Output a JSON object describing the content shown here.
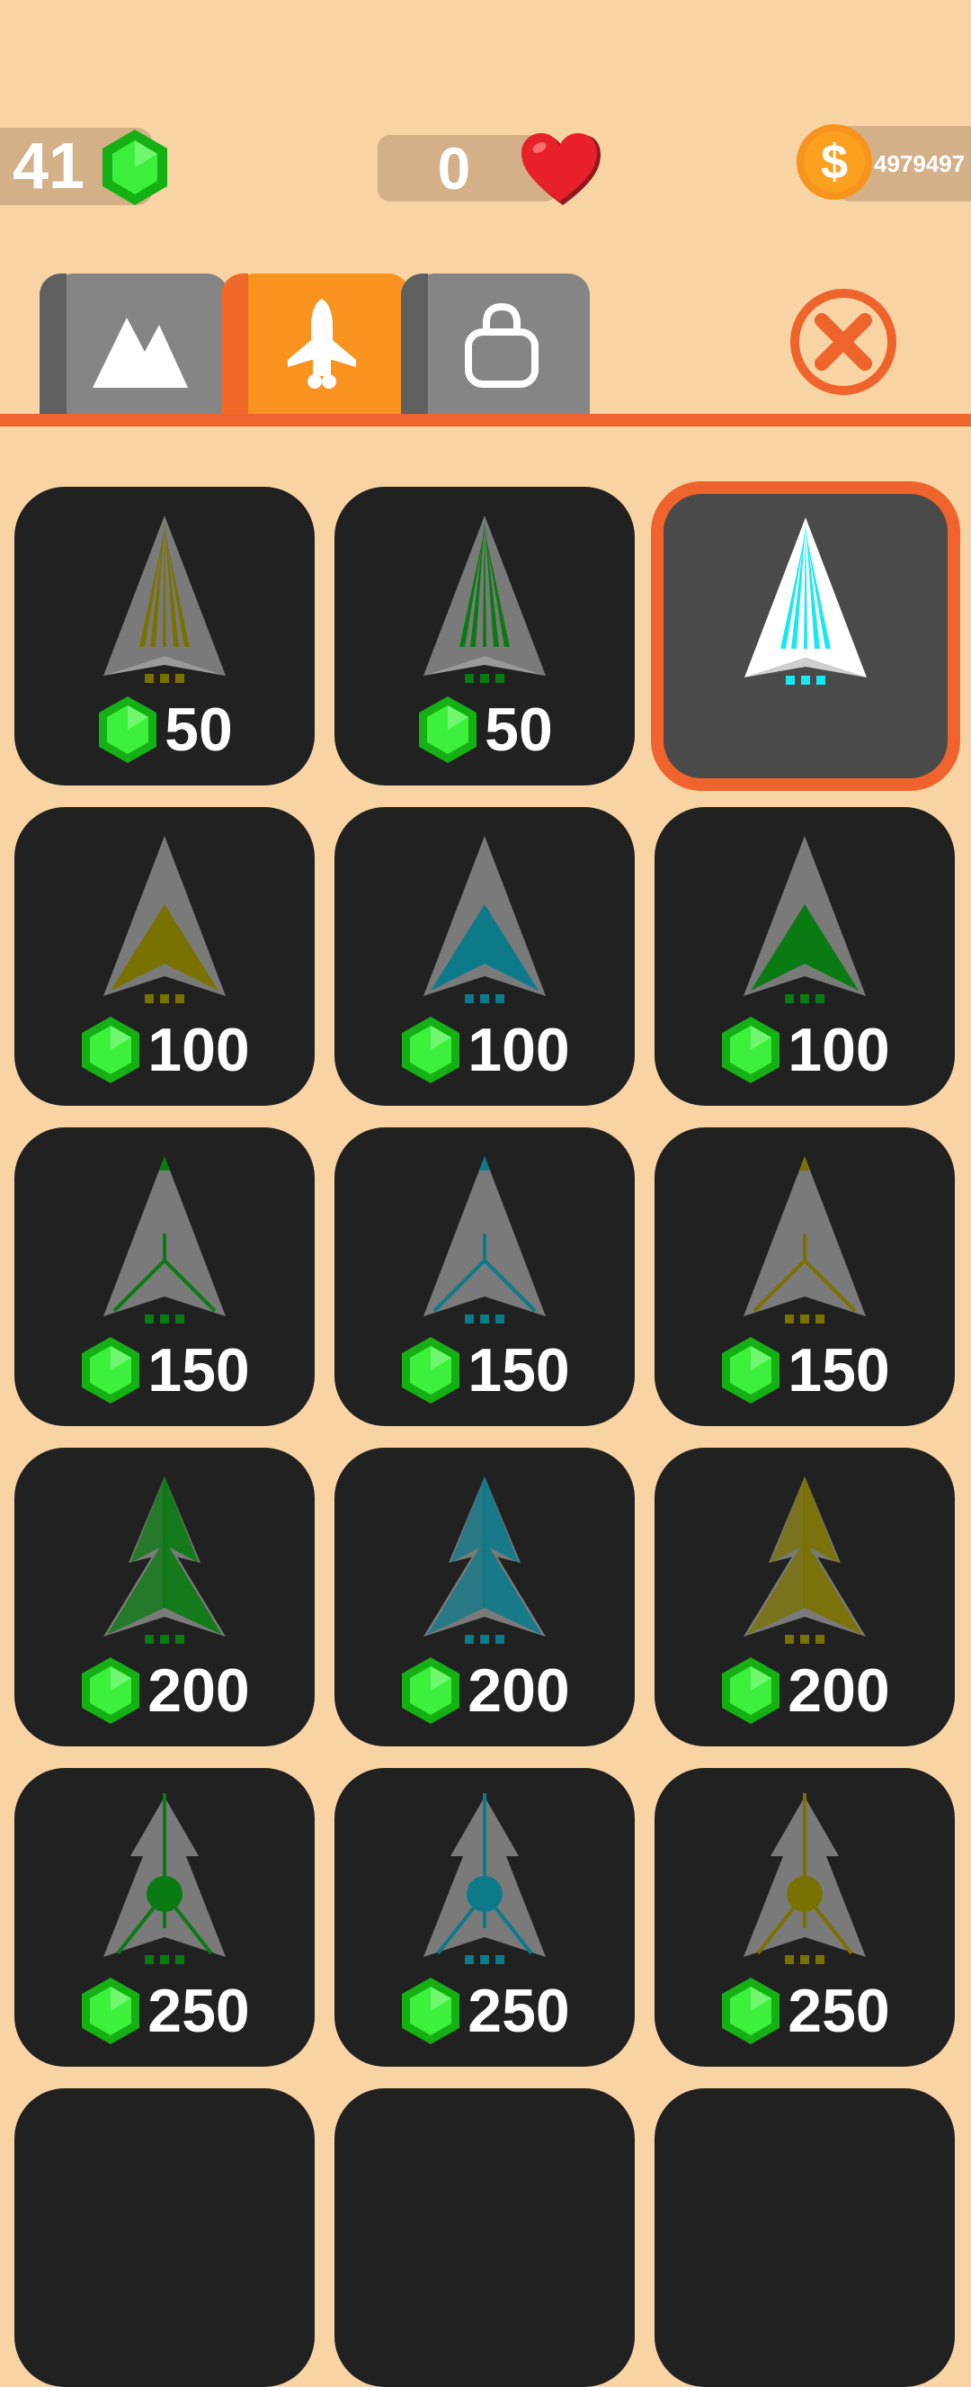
{
  "hud": {
    "gems": "41",
    "hearts": "0",
    "coins": "4979497",
    "coin_symbol": "$"
  },
  "tabs": [
    {
      "name": "map",
      "icon": "mountain-icon",
      "active": false
    },
    {
      "name": "ships",
      "icon": "rocket-icon",
      "active": true
    },
    {
      "name": "shop",
      "icon": "shopping-bag-icon",
      "active": false
    }
  ],
  "colors": {
    "background": "#f8d3a3",
    "accent": "#ef632c",
    "tab_active": "#f8931f",
    "tab_inactive": "#858585",
    "card": "#212121",
    "gem": "#22d422",
    "heart": "#e8202a",
    "coin": "#f7941d"
  },
  "ships": [
    {
      "price": "50",
      "style": "striped",
      "color": "#7a7200",
      "selected": false
    },
    {
      "price": "50",
      "style": "striped",
      "color": "#0a7a12",
      "selected": false
    },
    {
      "price": "",
      "style": "striped",
      "color": "#18e8f0",
      "selected": true
    },
    {
      "price": "100",
      "style": "chevron",
      "color": "#7a7200",
      "selected": false
    },
    {
      "price": "100",
      "style": "chevron",
      "color": "#0d7a8a",
      "selected": false
    },
    {
      "price": "100",
      "style": "chevron",
      "color": "#0a7a12",
      "selected": false
    },
    {
      "price": "150",
      "style": "wire",
      "color": "#0a7a12",
      "selected": false
    },
    {
      "price": "150",
      "style": "wire",
      "color": "#0d7a8a",
      "selected": false
    },
    {
      "price": "150",
      "style": "wire",
      "color": "#7a7200",
      "selected": false
    },
    {
      "price": "200",
      "style": "tree",
      "color": "#0a7a12",
      "selected": false
    },
    {
      "price": "200",
      "style": "tree",
      "color": "#0d7a8a",
      "selected": false
    },
    {
      "price": "200",
      "style": "tree",
      "color": "#7a7200",
      "selected": false
    },
    {
      "price": "250",
      "style": "orb",
      "color": "#0a7a12",
      "selected": false
    },
    {
      "price": "250",
      "style": "orb",
      "color": "#0d7a8a",
      "selected": false
    },
    {
      "price": "250",
      "style": "orb",
      "color": "#7a7200",
      "selected": false
    }
  ]
}
